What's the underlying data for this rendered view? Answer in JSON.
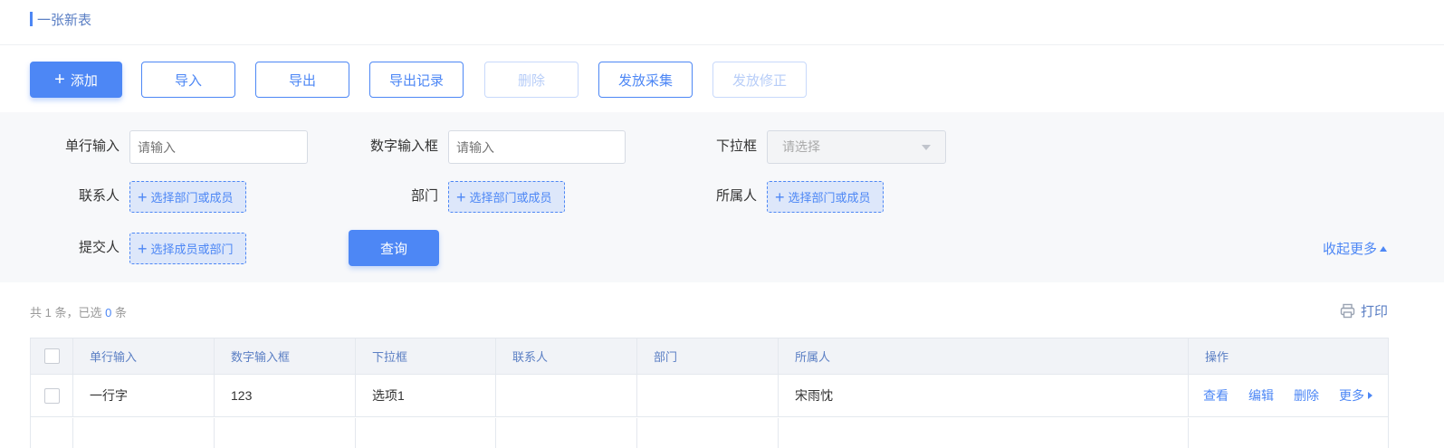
{
  "header": {
    "title": "一张新表"
  },
  "toolbar": {
    "add": "添加",
    "import": "导入",
    "export": "导出",
    "export_log": "导出记录",
    "delete": "删除",
    "distribute_collect": "发放采集",
    "distribute_modify": "发放修正"
  },
  "filter": {
    "single_line_label": "单行输入",
    "single_line_placeholder": "请输入",
    "number_label": "数字输入框",
    "number_placeholder": "请输入",
    "dropdown_label": "下拉框",
    "dropdown_placeholder": "请选择",
    "contact_label": "联系人",
    "contact_picker": "选择部门或成员",
    "dept_label": "部门",
    "dept_picker": "选择部门或成员",
    "owner_label": "所属人",
    "owner_picker": "选择部门或成员",
    "submitter_label": "提交人",
    "submitter_picker": "选择成员或部门",
    "query_button": "查询",
    "collapse": "收起更多"
  },
  "summary": {
    "prefix": "共 1 条，已选",
    "selected": "0",
    "suffix": "条"
  },
  "print": "打印",
  "table": {
    "columns": [
      "单行输入",
      "数字输入框",
      "下拉框",
      "联系人",
      "部门",
      "所属人",
      "操作"
    ],
    "rows": [
      {
        "single_line": "一行字",
        "number": "123",
        "dropdown": "选项1",
        "contact": "",
        "dept": "",
        "owner": "宋雨忱"
      }
    ],
    "actions": [
      "查看",
      "编辑",
      "删除",
      "更多"
    ]
  },
  "colors": {
    "accent": "#4d87f5",
    "filter_bg": "#f7f8fa",
    "header_bg": "#f1f3f7"
  }
}
